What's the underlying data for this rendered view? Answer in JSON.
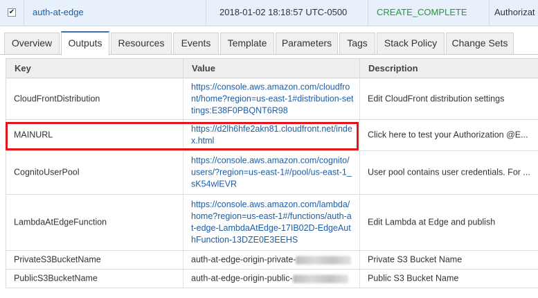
{
  "stack": {
    "name": "auth-at-edge",
    "created": "2018-01-02 18:18:57 UTC-0500",
    "status": "CREATE_COMPLETE",
    "description": "Authorizat",
    "status_color": "#1e9a3a"
  },
  "tabs": [
    {
      "label": "Overview"
    },
    {
      "label": "Outputs",
      "active": true
    },
    {
      "label": "Resources"
    },
    {
      "label": "Events"
    },
    {
      "label": "Template"
    },
    {
      "label": "Parameters"
    },
    {
      "label": "Tags"
    },
    {
      "label": "Stack Policy"
    },
    {
      "label": "Change Sets"
    }
  ],
  "columns": {
    "key": "Key",
    "value": "Value",
    "description": "Description"
  },
  "outputs": [
    {
      "key": "CloudFrontDistribution",
      "value": "https://console.aws.amazon.com/cloudfront/home?region=us-east-1#distribution-settings:E38F0PBQNT6R98",
      "description": "Edit CloudFront distribution settings"
    },
    {
      "key": "MAINURL",
      "value": "https://d2lh6hfe2akn81.cloudfront.net/index.html",
      "description": "Click here to test your Authorization @E..."
    },
    {
      "key": "CognitoUserPool",
      "value": "https://console.aws.amazon.com/cognito/users/?region=us-east-1#/pool/us-east-1_sK54wlEVR",
      "description": "User pool contains user credentials. For ..."
    },
    {
      "key": "LambdaAtEdgeFunction",
      "value": "https://console.aws.amazon.com/lambda/home?region=us-east-1#/functions/auth-at-edge-LambdaAtEdge-17IB02D-EdgeAuthFunction-13DZE0E3EEHS",
      "description": "Edit Lambda at Edge and publish"
    },
    {
      "key": "PrivateS3BucketName",
      "value": "auth-at-edge-origin-private-",
      "description": "Private S3 Bucket Name"
    },
    {
      "key": "PublicS3BucketName",
      "value": "auth-at-edge-origin-public-",
      "description": "Public S3 Bucket Name"
    }
  ],
  "colors": {
    "link": "#1a5ea8",
    "highlight": "#e3141a",
    "active_tab_accent": "#3b6fb6"
  }
}
